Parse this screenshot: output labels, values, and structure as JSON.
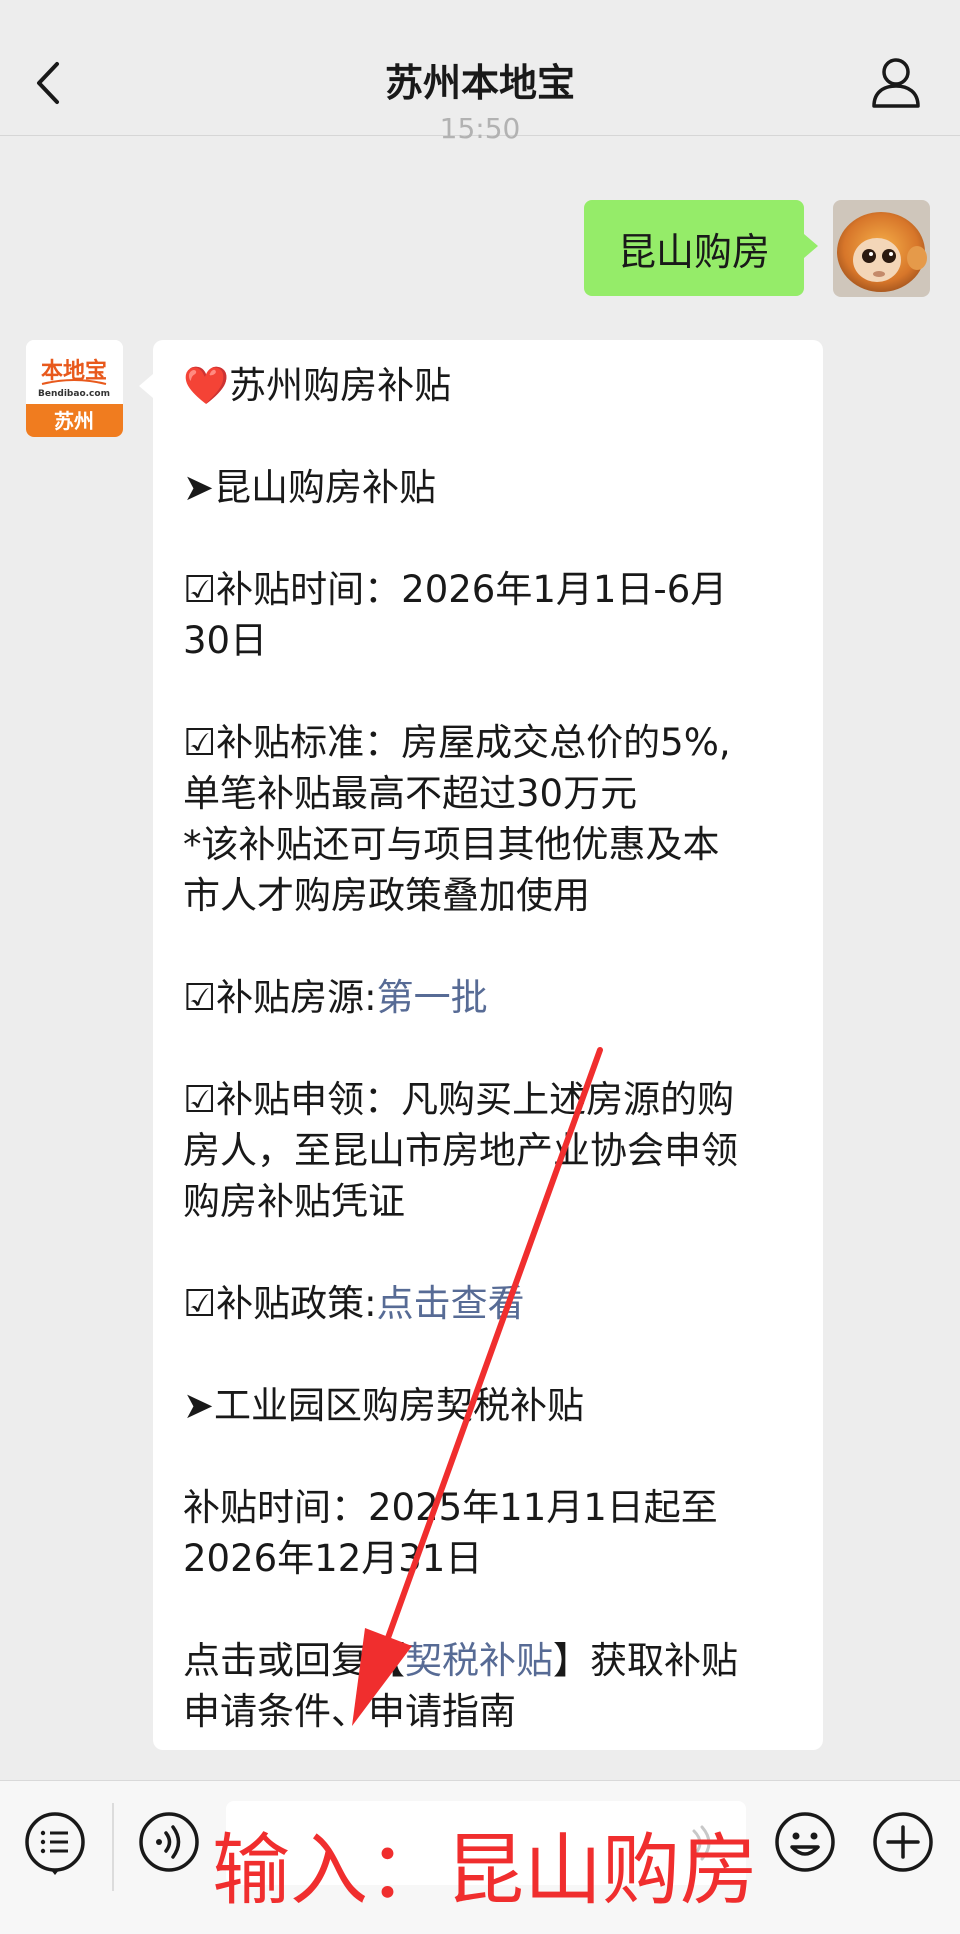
{
  "header": {
    "title": "苏州本地宝",
    "back_icon": "chevron-left-icon",
    "profile_icon": "person-icon"
  },
  "timestamp": "15:50",
  "user_message": {
    "text": "昆山购房"
  },
  "bot_avatar": {
    "brand": "本地宝",
    "domain": "Bendibao.com",
    "city": "苏州"
  },
  "bot_message": {
    "title": "苏州购房补贴",
    "section1_heading": "➤昆山购房补贴",
    "time_line1": "☑补贴时间：2026年1月1日-6月",
    "time_line2": "30日",
    "std_line1": "☑补贴标准：房屋成交总价的5%,",
    "std_line2": "单笔补贴最高不超过30万元",
    "std_line3": "*该补贴还可与项目其他优惠及本",
    "std_line4": "市人才购房政策叠加使用",
    "source_label": "☑补贴房源:",
    "source_link": "第一批",
    "apply_line1": "☑补贴申领：凡购买上述房源的购",
    "apply_line2": "房人，至昆山市房地产业协会申领",
    "apply_line3": "购房补贴凭证",
    "policy_label": "☑补贴政策:",
    "policy_link": "点击查看",
    "section2_heading": "➤工业园区购房契税补贴",
    "sip_time_line1": "补贴时间：2025年11月1日起至",
    "sip_time_line2": "2026年12月31日",
    "reply_prefix": "点击或回复【",
    "reply_link": "契税补贴",
    "reply_suffix": "】获取补贴",
    "reply_line2": "申请条件、申请指南"
  },
  "annotation": {
    "text": "输入：昆山购房",
    "color": "#f02e2e"
  },
  "bottom_bar": {
    "menu_icon": "list-menu-icon",
    "voice_icon": "voice-icon",
    "emoji_icon": "emoji-icon",
    "plus_icon": "plus-icon"
  },
  "colors": {
    "background": "#ededed",
    "user_bubble": "#95ec69",
    "bot_bubble": "#ffffff",
    "link": "#576b95",
    "annotation": "#f02e2e"
  }
}
